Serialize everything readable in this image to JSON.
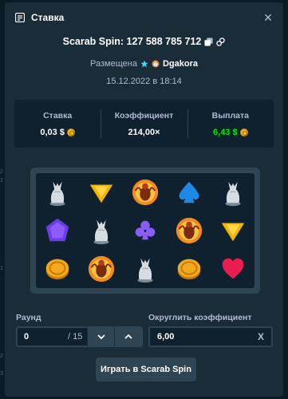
{
  "modal": {
    "title": "Ставка",
    "bet_id": "Scarab Spin: 127 588 785 712",
    "placed_label": "Размещена",
    "username": "Dgakora",
    "date": "15.12.2022 в 18:14"
  },
  "stats": {
    "bet_label": "Ставка",
    "bet_value": "0,03 $",
    "multiplier_label": "Коэффициент",
    "multiplier_value": "214,00×",
    "payout_label": "Выплата",
    "payout_value": "6,43 $"
  },
  "reels": [
    [
      "scarab-beetle-statue",
      "gold-triangle",
      "golden-scarab",
      "blue-spade",
      "scarab-beetle-statue"
    ],
    [
      "purple-gem",
      "scarab-beetle-statue",
      "purple-club",
      "golden-scarab",
      "gold-triangle"
    ],
    [
      "gold-coin",
      "golden-scarab",
      "scarab-beetle-statue",
      "gold-coin",
      "red-heart"
    ]
  ],
  "form": {
    "round_label": "Раунд",
    "round_value": "0",
    "round_total": "/ 15",
    "round_coef_label": "Округлить коэффициент",
    "round_coef_value": "6,00",
    "round_coef_suffix": "X",
    "play_button": "Играть в Scarab Spin"
  },
  "edge_marks": [
    "2",
    "2",
    "",
    "",
    "",
    "",
    "",
    "",
    "",
    "",
    "",
    "1",
    "",
    "",
    "",
    "",
    "",
    "",
    "",
    "",
    "",
    "2",
    "",
    "3"
  ],
  "colors": {
    "background": "#1a2c38",
    "panel": "#0f212e",
    "accent_green": "#00e701",
    "coin": "#f2b90d"
  }
}
